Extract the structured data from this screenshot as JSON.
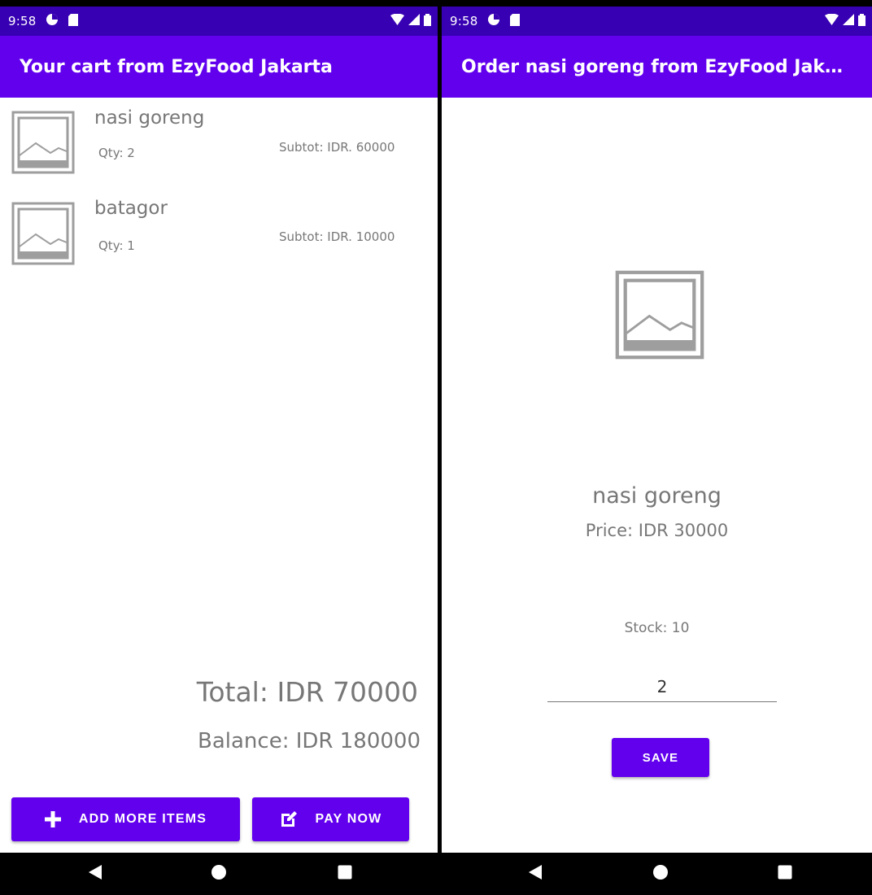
{
  "theme": {
    "primary": "#6200EE",
    "status_bar": "#3700B3",
    "text_gray": "#777777"
  },
  "status_bar": {
    "time": "9:58",
    "icons": [
      "pie-chart-icon",
      "sd-card-icon",
      "wifi-icon",
      "signal-icon",
      "battery-icon"
    ]
  },
  "cart_screen": {
    "title": "Your cart from EzyFood Jakarta",
    "items": [
      {
        "name": "nasi goreng",
        "qty": "Qty: 2",
        "subtotal": "Subtot: IDR. 60000",
        "icon": "image-placeholder-icon"
      },
      {
        "name": "batagor",
        "qty": "Qty: 1",
        "subtotal": "Subtot: IDR. 10000",
        "icon": "image-placeholder-icon"
      }
    ],
    "total": "Total: IDR 70000",
    "balance": "Balance: IDR 180000",
    "add_more_button": "ADD MORE ITEMS",
    "pay_now_button": "PAY NOW"
  },
  "order_screen": {
    "title": "Order nasi goreng from EzyFood Jak…",
    "item_name": "nasi goreng",
    "price": "Price: IDR 30000",
    "stock": "Stock: 10",
    "quantity_value": "2",
    "save_button": "SAVE"
  },
  "nav_bar": {
    "icons": [
      "back-triangle-icon",
      "home-circle-icon",
      "recents-square-icon"
    ]
  }
}
